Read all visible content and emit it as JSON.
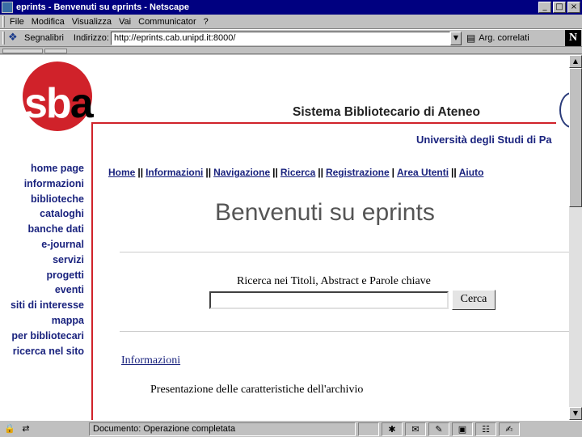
{
  "window": {
    "title": "eprints - Benvenuti su eprints - Netscape",
    "controls": {
      "minimize": "_",
      "maximize": "□",
      "close": "×"
    }
  },
  "menubar": {
    "items": [
      "File",
      "Modifica",
      "Visualizza",
      "Vai",
      "Communicator",
      "?"
    ]
  },
  "toolbar": {
    "bookmarks_label": "Segnalibri",
    "address_label": "Indirizzo:",
    "address_value": "http://eprints.cab.unipd.it:8000/",
    "related_label": "Arg. correlati",
    "netscape_logo": "N"
  },
  "page": {
    "logo_text_s": "sb",
    "logo_text_a": "a",
    "header_title": "Sistema Bibliotecario di Ateneo",
    "university_name": "Università degli Studi di Pa",
    "left_nav": [
      "home page",
      "informazioni",
      "biblioteche",
      "cataloghi",
      "banche dati",
      "e-journal",
      "servizi",
      "progetti",
      "eventi",
      "siti di interesse",
      "mappa",
      "per bibliotecari",
      "ricerca nel sito"
    ],
    "top_nav": [
      "Home",
      "Informazioni",
      "Navigazione",
      "Ricerca",
      "Registrazione",
      "Area Utenti",
      "Aiuto"
    ],
    "top_nav_separators": [
      "||",
      "||",
      "||",
      "||",
      "|",
      "||"
    ],
    "heading": "Benvenuti su eprints",
    "search_label": "Ricerca nei Titoli, Abstract e Parole chiave",
    "search_value": "",
    "search_button": "Cerca",
    "info_link": "Informazioni",
    "info_description": "Presentazione delle caratteristiche dell'archivio"
  },
  "statusbar": {
    "text": "Documento: Operazione completata"
  }
}
